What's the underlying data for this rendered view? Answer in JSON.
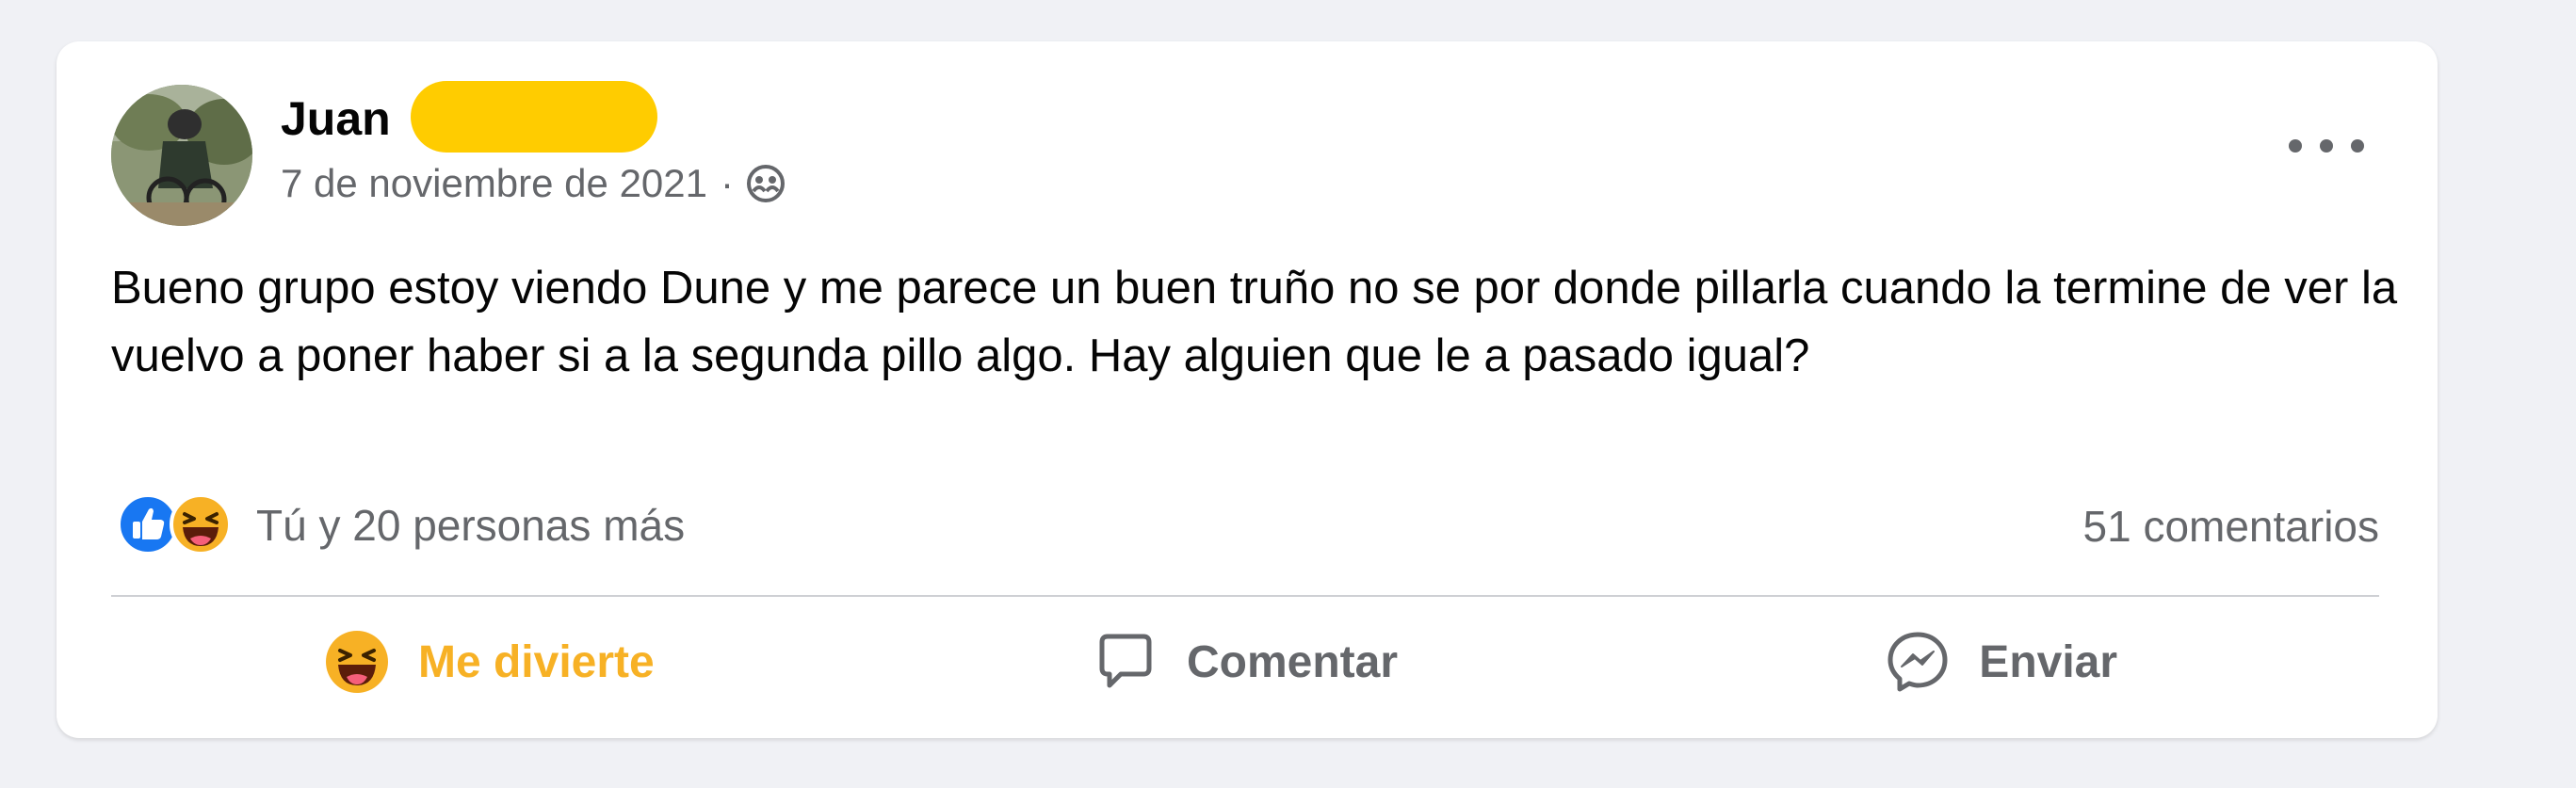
{
  "post": {
    "author_name": "Juan",
    "date": "7 de noviembre de 2021",
    "separator": "·",
    "privacy_icon": "friends-globe-icon",
    "text": "Bueno grupo estoy viendo Dune y me parece un buen truño no se por donde pillarla cuando la termine de ver la vuelvo a poner haber si a la segunda pillo algo. Hay alguien que le a pasado igual?",
    "more_icon": "more-options-icon"
  },
  "reactions": {
    "icons": [
      "like-icon",
      "haha-icon"
    ],
    "summary": "Tú y 20 personas más",
    "comments": "51 comentarios"
  },
  "actions": {
    "react_label": "Me divierte",
    "comment_label": "Comentar",
    "send_label": "Enviar"
  },
  "colors": {
    "background": "#f0f1f5",
    "card": "#ffffff",
    "secondary_text": "#65676b",
    "like_blue": "#1877f2",
    "haha_yellow": "#f7b125",
    "redaction": "#ffcc00"
  }
}
